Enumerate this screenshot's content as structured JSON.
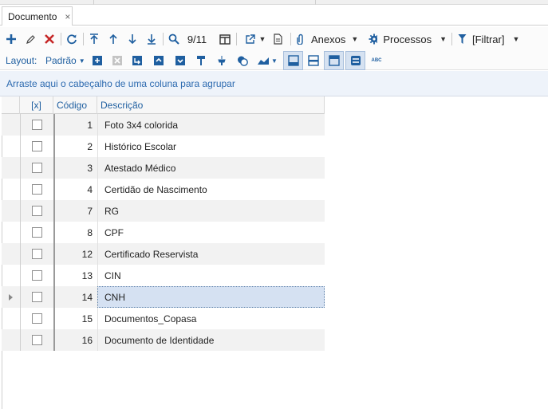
{
  "tabs": [
    {
      "label": "Documento",
      "close": "×"
    }
  ],
  "toolbar": {
    "record_position": "9/11",
    "attachments_label": "Anexos",
    "processes_label": "Processos",
    "filter_label": "[Filtrar]"
  },
  "layoutbar": {
    "layout_label": "Layout:",
    "layout_value": "Padrão",
    "abc_label": "ABC"
  },
  "groupbar": {
    "hint": "Arraste aqui o cabeçalho de uma coluna para agrupar"
  },
  "grid": {
    "columns": [
      "[x]",
      "Código",
      "Descrição"
    ],
    "rows": [
      {
        "code": "1",
        "desc": "Foto 3x4 colorida"
      },
      {
        "code": "2",
        "desc": "Histórico Escolar"
      },
      {
        "code": "3",
        "desc": "Atestado Médico"
      },
      {
        "code": "4",
        "desc": "Certidão de Nascimento"
      },
      {
        "code": "7",
        "desc": "RG"
      },
      {
        "code": "8",
        "desc": "CPF"
      },
      {
        "code": "12",
        "desc": "Certificado Reservista"
      },
      {
        "code": "13",
        "desc": "CIN"
      },
      {
        "code": "14",
        "desc": "CNH",
        "selected": true
      },
      {
        "code": "15",
        "desc": "Documentos_Copasa"
      },
      {
        "code": "16",
        "desc": "Documento de Identidade"
      }
    ]
  },
  "colors": {
    "accent": "#1f5fa0",
    "selection": "#d5e1f2",
    "delete": "#c62828",
    "group_bg": "#eef3fa"
  }
}
